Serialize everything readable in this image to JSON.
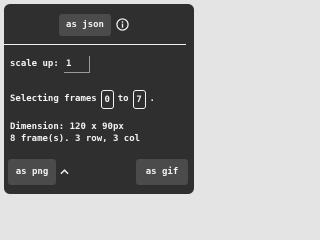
{
  "export": {
    "json_label": "as json",
    "info_icon": "info-circle-icon",
    "png_label": "as png",
    "png_menu_icon": "chevron-up-icon",
    "gif_label": "as gif"
  },
  "scale": {
    "label": "scale up:",
    "value": "1"
  },
  "frames": {
    "prefix": "Selecting frames",
    "start": "0",
    "to": "to",
    "end": "7",
    "suffix": "."
  },
  "info": {
    "dimension": "Dimension: 120 x 90px",
    "frame_count": "8 frame(s). 3 row, 3 col"
  },
  "colors": {
    "panel_bg": "#2f2f2f",
    "button_bg": "#4b4b4b",
    "text": "#f2f2f2",
    "page_bg": "#e4e4e4"
  }
}
